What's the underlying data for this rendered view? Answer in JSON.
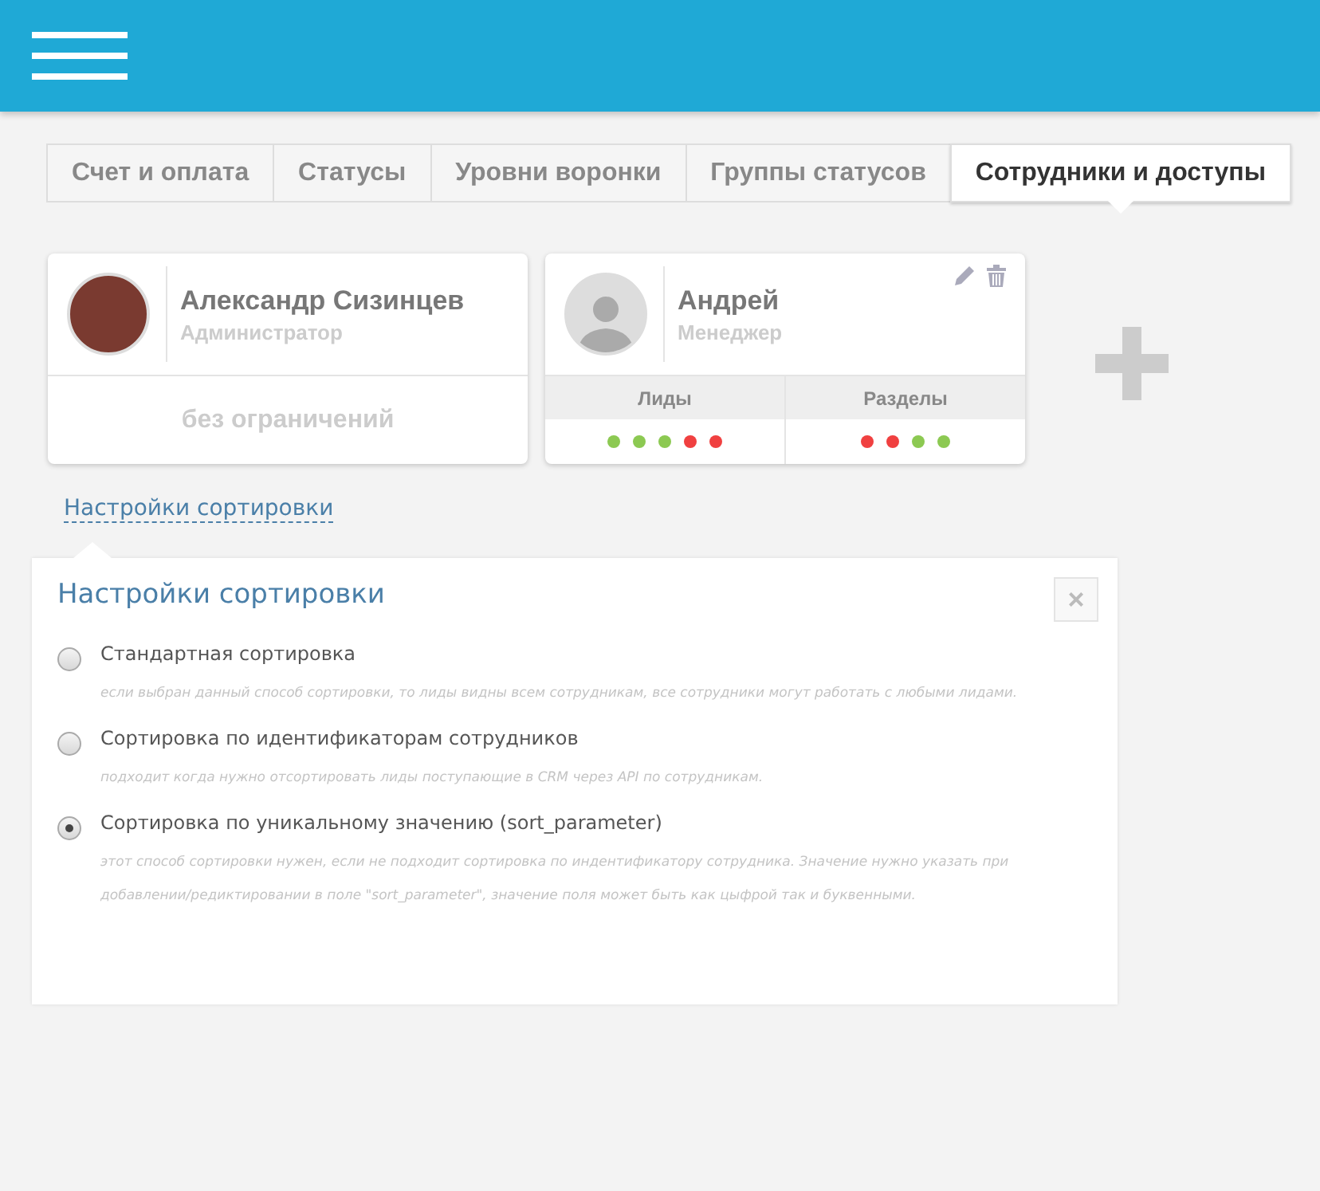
{
  "tabs": [
    {
      "label": "Счет и оплата",
      "selected": false
    },
    {
      "label": "Статусы",
      "selected": false
    },
    {
      "label": "Уровни воронки",
      "selected": false
    },
    {
      "label": "Группы статусов",
      "selected": false
    },
    {
      "label": "Сотрудники и доступы",
      "selected": true
    }
  ],
  "employees": [
    {
      "kind": "full",
      "name": "Александр Сизинцев",
      "role": "Администратор",
      "photo": true,
      "access": "без ограничений"
    },
    {
      "kind": "limited",
      "name": "Андрей",
      "role": "Менеджер",
      "photo": false,
      "columns": [
        {
          "title": "Лиды",
          "dots": [
            {
              "color": "#8cc952"
            },
            {
              "color": "#8cc952"
            },
            {
              "color": "#8cc952"
            },
            {
              "color": "#f04040"
            },
            {
              "color": "#f04040"
            }
          ]
        },
        {
          "title": "Разделы",
          "dots": [
            {
              "color": "#f04040"
            },
            {
              "color": "#f04040"
            },
            {
              "color": "#8cc952"
            },
            {
              "color": "#8cc952"
            }
          ]
        }
      ]
    }
  ],
  "sort_link": "Настройки сортировки",
  "panel": {
    "title": "Настройки сортировки",
    "close": "×",
    "options": [
      {
        "label": "Стандартная сортировка",
        "description": "если выбран данный способ сортировки, то лиды видны всем сотрудникам, все сотрудники могут работать с любыми лидами.",
        "selected": false
      },
      {
        "label": "Сортировка по идентификаторам сотрудников",
        "description": "подходит когда нужно отсортировать лиды поступающие в CRM через API по сотрудникам.",
        "selected": false
      },
      {
        "label": "Сортировка по уникальному значению (sort_parameter)",
        "description": "этот способ сортировки нужен, если не подходит сортировка по индентификатору сотрудника. Значение нужно указать при добавлении/редиктировании в поле \"sort_parameter\", значение поля может быть как цыфрой так и буквенными.",
        "selected": true
      }
    ]
  }
}
